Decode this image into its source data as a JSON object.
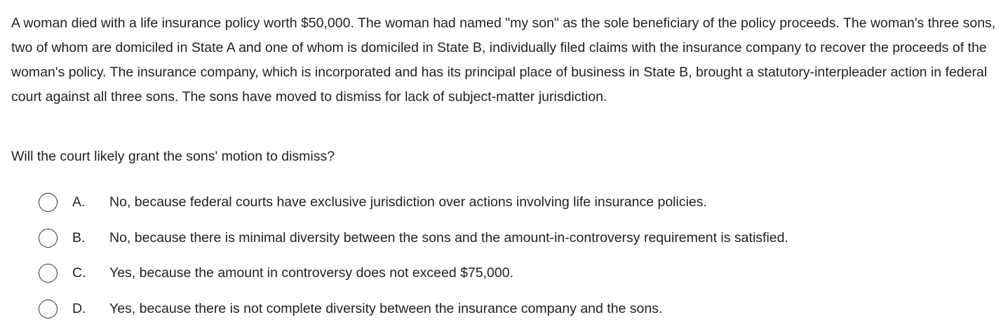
{
  "question": {
    "stem": "A woman died with a life insurance policy worth $50,000.  The woman had named \"my son\" as the sole beneficiary of the policy proceeds.  The woman's three sons, two of whom are domiciled in State A and one of whom is domiciled in State B, individually filed claims with the insurance company to recover the proceeds of the woman's policy.  The insurance company, which is incorporated and has its principal place of business in State B, brought a statutory-interpleader action in federal court against all three sons.  The sons have moved to dismiss for lack of subject-matter jurisdiction.",
    "prompt": "Will the court likely grant the sons' motion to dismiss?"
  },
  "options": [
    {
      "letter": "A.",
      "text": "No, because federal courts have exclusive jurisdiction over actions involving life insurance policies."
    },
    {
      "letter": "B.",
      "text": "No, because there is minimal diversity between the sons and the amount-in-controversy requirement is satisfied."
    },
    {
      "letter": "C.",
      "text": "Yes, because the amount in controversy does not exceed $75,000."
    },
    {
      "letter": "D.",
      "text": "Yes, because there is not complete diversity between the insurance company and the sons."
    }
  ]
}
